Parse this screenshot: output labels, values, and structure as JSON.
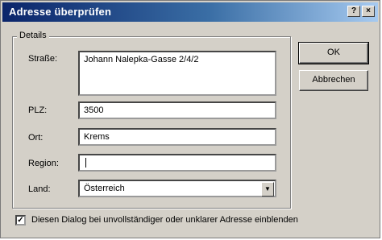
{
  "window": {
    "title": "Adresse überprüfen",
    "help_glyph": "?",
    "close_glyph": "×"
  },
  "group": {
    "legend": "Details"
  },
  "fields": {
    "street_label": "Straße:",
    "street_value": "Johann Nalepka-Gasse 2/4/2",
    "zip_label": "PLZ:",
    "zip_value": "3500",
    "city_label": "Ort:",
    "city_value": "Krems",
    "region_label": "Region:",
    "region_value": "",
    "country_label": "Land:",
    "country_value": "Österreich",
    "country_dropdown_glyph": "▼"
  },
  "buttons": {
    "ok": "OK",
    "cancel": "Abbrechen"
  },
  "checkbox": {
    "checked": true,
    "mark": "✓",
    "label": "Diesen Dialog bei unvollständiger oder unklarer Adresse einblenden"
  }
}
